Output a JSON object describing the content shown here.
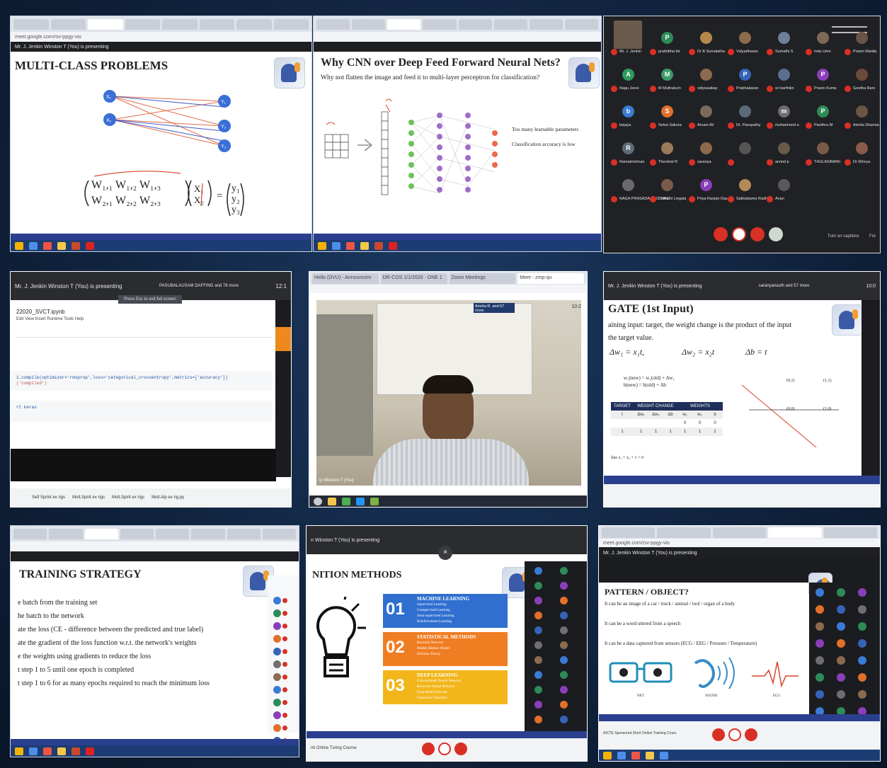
{
  "tile1": {
    "url": "meet.google.com/rsv-ppgy-vio",
    "presenter": "Mr. J. Jenkin Winston T (You) is presenting",
    "title": "MULTI-CLASS PROBLEMS",
    "inputs": [
      "X₁",
      "X₂"
    ],
    "outputs": [
      "Y₁",
      "Y₂",
      "Y₃"
    ],
    "matrix_row1": "W₁,₁   W₁,₂   W₁,₃",
    "matrix_row2": "W₂,₁   W₂,₂   W₂,₃",
    "vec_x": [
      "X₁",
      "X₂"
    ],
    "vec_y": [
      "y₁",
      "y₂",
      "y₃"
    ]
  },
  "tile2": {
    "title": "Why CNN over Deep Feed Forward Neural Nets?",
    "subtitle": "Why not flatten the image and feed it to multi-layer perceptron  for classification?",
    "note1": "Too many learnable parameters",
    "note2": "Classification accuracy is low"
  },
  "tile3": {
    "participants": [
      {
        "name": "Mr. J. Jenkin",
        "initial": "",
        "color": "#6b5a4c",
        "video": true
      },
      {
        "name": "prathibha bir",
        "initial": "P",
        "color": "#2e8b57"
      },
      {
        "name": "Dr B Sumalatha",
        "initial": "",
        "color": "#b5884a"
      },
      {
        "name": "Vidyadharan",
        "initial": "",
        "color": "#8a6b4a"
      },
      {
        "name": "Sumathi S",
        "initial": "",
        "color": "#6f7f9a"
      },
      {
        "name": "Indu Unni",
        "initial": "",
        "color": "#7c6a57"
      },
      {
        "name": "Pravin Manila",
        "initial": "",
        "color": "#6a5445"
      },
      {
        "name": "Nagu Jeevi",
        "initial": "A",
        "color": "#2f9b5f"
      },
      {
        "name": "M Muthukum",
        "initial": "M",
        "color": "#3a9a6a"
      },
      {
        "name": "vidyasaikay",
        "initial": "",
        "color": "#8b6a50"
      },
      {
        "name": "Prabhakaran",
        "initial": "P",
        "color": "#3563b8"
      },
      {
        "name": "sri karthikn",
        "initial": "",
        "color": "#5b6f90"
      },
      {
        "name": "Pravin Kuma",
        "initial": "P",
        "color": "#8a3fb8"
      },
      {
        "name": "Geetha Rani",
        "initial": "",
        "color": "#6b4a3a"
      },
      {
        "name": "bejaya",
        "initial": "b",
        "color": "#3a7bd5"
      },
      {
        "name": "Selva Sakura",
        "initial": "S",
        "color": "#e0702a"
      },
      {
        "name": "Anusri Ali",
        "initial": "",
        "color": "#7a6a5a"
      },
      {
        "name": "Dr. Pasupathy",
        "initial": "",
        "color": "#5a6a7a"
      },
      {
        "name": "muhammed a",
        "initial": "m",
        "color": "#6f6f6f"
      },
      {
        "name": "Pavithra M",
        "initial": "P",
        "color": "#2e8b57"
      },
      {
        "name": "Amrita Sharma",
        "initial": "",
        "color": "#6b5545"
      },
      {
        "name": "Ramakrishnan",
        "initial": "R",
        "color": "#5c6b7a"
      },
      {
        "name": "Thendral R",
        "initial": "",
        "color": "#9a7a5a"
      },
      {
        "name": "saranya",
        "initial": "",
        "color": "#8a6a4a"
      },
      {
        "name": "",
        "initial": "",
        "color": "#555"
      },
      {
        "name": "arvind p",
        "initial": "",
        "color": "#6a5a4a"
      },
      {
        "name": "THULASIMANI",
        "initial": "",
        "color": "#7a5a4a"
      },
      {
        "name": "Dr Dhivya",
        "initial": "",
        "color": "#8a5a4a"
      },
      {
        "name": "NAGA PRASADA RAO TIRU",
        "initial": "",
        "color": "#6a6a6a"
      },
      {
        "name": "Sumathi Lingala",
        "initial": "",
        "color": "#7a5a4a"
      },
      {
        "name": "Priya Ranjan Das",
        "initial": "P",
        "color": "#8a3fb8"
      },
      {
        "name": "Sathiabama Radha",
        "initial": "",
        "color": "#b58a5a"
      },
      {
        "name": "Anan",
        "initial": "",
        "color": "#5a5a5a"
      }
    ],
    "captions": "Turn on captions",
    "more": "Fre"
  },
  "tile4": {
    "presenter": "Mr. J. Jenkin Winston T (You) is presenting",
    "others": "PASUBALAUSAM DAFFING and 78 more",
    "toast": "Press  Esc  to exit full screen",
    "notebook": "22020_SVCT.ipynb",
    "menu": "Edit  View  Insert  Runtime  Tools  Help",
    "code": "1.compile(optimizer='rmsprop',loss='categorical_crossentropy',metrics=['accuracy'])",
    "code2": "('compiled')",
    "code3": "rt keras",
    "tabs": [
      "Self Sprint ex rigs",
      "Mult.Spirit ex rigs",
      "Mult.Spirit ex rigs",
      "Mult.Alp ex rig.py"
    ],
    "time": "12:1"
  },
  "tile5": {
    "tabs": [
      "Hello (DVU) - Announcem",
      "DR-COS 1/1/2020 · ONE 1",
      "Zoom Meetings",
      "Meet - zmp-qu"
    ],
    "time": "10:2",
    "caption": "ip Winston T (You)",
    "others": "Amrita R. and 57 more"
  },
  "tile6": {
    "presenter": "Mr. J. Jenkin Winston T (You) is presenting",
    "others": "saranyanauth and 57 more",
    "time": "10:0",
    "title": "GATE (1st Input)",
    "line1": "aining input: target, the weight change is the product of the input",
    "line2": "the target value.",
    "eq1": "Δw₁ = x₁t,",
    "eq2": "Δw₂ = x₂t",
    "eq3": "Δb = t",
    "upd1": "w₁(new) = w₁(old) + Δw₁",
    "upd2": "b(new) = b(old) + Δb",
    "table_head": [
      "TARGET",
      "WEIGHT CHANGE",
      "WEIGHTS"
    ],
    "table_sub": [
      "t",
      "Δw₁",
      "Δw₂",
      "Δb",
      "w₁",
      "w₂",
      "b"
    ],
    "table_rows": [
      [
        "",
        "",
        "",
        "",
        "0",
        "0",
        "0"
      ],
      [
        "1",
        "1",
        "1",
        "1",
        "1",
        "1",
        "1"
      ]
    ],
    "points": [
      "(0,1)",
      "(1,1)",
      "(0,0)",
      "(1,0)"
    ],
    "foot": "line x₁ + x₂ + 1 = 0"
  },
  "tile7": {
    "title": "TRAINING STRATEGY",
    "lines": [
      "e batch from the training set",
      "he batch to the network",
      "ate the loss (CE - difference between the predicted and true label)",
      "ate the gradient of the loss function w.r.t. the network's weights",
      "e the weights using gradients to reduce the loss",
      "t step 1 to 5 until one epoch is completed",
      "t step 1 to 6 for as many epochs required to reach the minimum loss"
    ]
  },
  "tile8": {
    "presenter": "n Winston T (You) is presenting",
    "title": "NITION METHODS",
    "blocks": [
      {
        "num": "01",
        "title": "MACHINE LEARNING",
        "items": [
          "Supervised Learning",
          "Unsupervised Learning",
          "Semi-supervised Learning",
          "Reinforcement Learning"
        ],
        "color": "#2f6fd0"
      },
      {
        "num": "02",
        "title": "STATISTICAL METHODS",
        "items": [
          "Bayesian Network",
          "Hidden Markov Model",
          "Decision Theory"
        ],
        "color": "#ef7d22"
      },
      {
        "num": "03",
        "title": "DEEP LEARNING",
        "items": [
          "Convolutional Neural Network",
          "Recurrent Neural Network",
          "Deep Belief Network",
          "Generative Networks"
        ],
        "color": "#f2b61b"
      }
    ],
    "bottom": "nk Online Turing Course"
  },
  "tile9": {
    "presenter": "Mr. J. Jenkin Winston T (You) is presenting",
    "url": "meet.google.com/rsv-ppgy-vio",
    "title": "PATTERN / OBJECT?",
    "lines": [
      "It can be an image of a car / truck / animal / tool / organ of a body",
      "It can be a word uttered from a speech",
      "It can be a data captured from sensors (ECG / EEG / Pressure / Temperature)"
    ],
    "labels": [
      "NET",
      "SOUND",
      "ECG"
    ],
    "bottom": "AICTE Sponsored Short Online Training Cours"
  }
}
